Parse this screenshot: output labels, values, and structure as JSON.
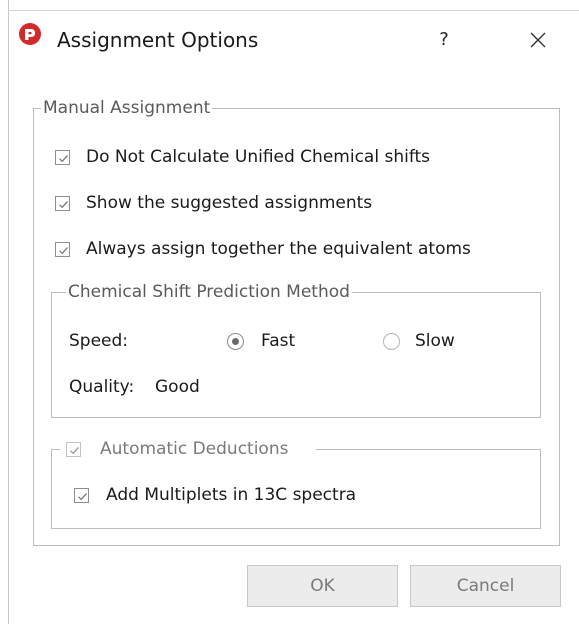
{
  "window": {
    "title": "Assignment Options",
    "help_label": "?",
    "app_icon": "mnova-logo-icon",
    "brand_color": "#d02a2a"
  },
  "manual_assignment": {
    "title": "Manual Assignment",
    "options": [
      {
        "label": "Do Not Calculate Unified Chemical shifts",
        "checked": true
      },
      {
        "label": "Show the suggested assignments",
        "checked": true
      },
      {
        "label": "Always assign together the equivalent  atoms",
        "checked": true
      }
    ]
  },
  "prediction": {
    "title": "Chemical Shift Prediction Method",
    "speed_label": "Speed:",
    "speed_options": [
      {
        "label": "Fast",
        "selected": true
      },
      {
        "label": "Slow",
        "selected": false
      }
    ],
    "quality_label": "Quality:",
    "quality_value": "Good"
  },
  "automatic_deductions": {
    "title": "Automatic Deductions",
    "checked": true,
    "options": [
      {
        "label": "Add Multiplets in 13C spectra",
        "checked": true
      }
    ]
  },
  "buttons": {
    "ok": "OK",
    "cancel": "Cancel"
  }
}
